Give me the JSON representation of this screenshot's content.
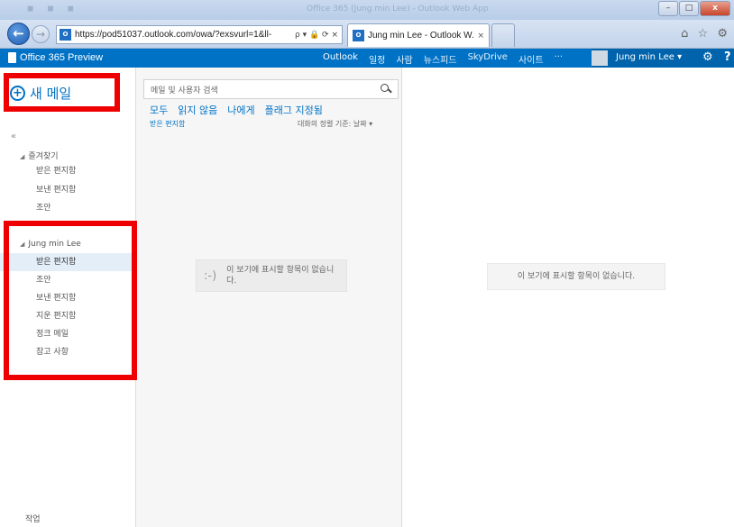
{
  "browser": {
    "window_title_blurred": "Office 365 (Jung min Lee) - Outlook Web App",
    "window_buttons": {
      "minimize": "–",
      "maximize": "□",
      "close": "x"
    },
    "address_url": "https://pod51037.outlook.com/owa/?exsvurl=1&ll-",
    "address_icons": "ρ ▾ 🔒 ⟳ ×",
    "tab_title": "Jung min Lee - Outlook W...",
    "tab_close": "×",
    "favicon_text": "O",
    "tool_icons": "⌂ ☆ ⚙"
  },
  "o365": {
    "brand": "Office 365 Preview",
    "nav": [
      "Outlook",
      "일정",
      "사람",
      "뉴스피드",
      "SkyDrive",
      "사이트",
      "···"
    ],
    "active_nav": "Outlook",
    "user": "Jung min Lee ▾",
    "settings": "⚙",
    "help": "?"
  },
  "left": {
    "new_mail": "새 메일",
    "new_mail_icon": "+",
    "collapse": "«",
    "favorites_header": "즐겨찾기",
    "favorites": [
      "받은 편지함",
      "보낸 편지함",
      "조안"
    ],
    "account_header": "Jung min Lee",
    "account_folders": [
      "받은 편지함",
      "조안",
      "보낸 편지함",
      "지운 편지함",
      "정크 메일",
      "참고 사항"
    ],
    "tasks": "작업"
  },
  "list": {
    "search_placeholder": "메일 및 사용자 검색",
    "filters": [
      "모두",
      "읽지 않음",
      "나에게",
      "플래그 지정됨"
    ],
    "folder_label": "받은 편지함",
    "sort_label": "대화의 정렬 기준: 날짜 ▾",
    "empty_face": ":-)",
    "empty_text": "이 보기에 표시할 항목이 없습니다."
  },
  "reading": {
    "empty_text": "이 보기에 표시할 항목이 없습니다."
  },
  "colors": {
    "brand_blue": "#0072c6",
    "highlight_red": "#ee0000"
  }
}
